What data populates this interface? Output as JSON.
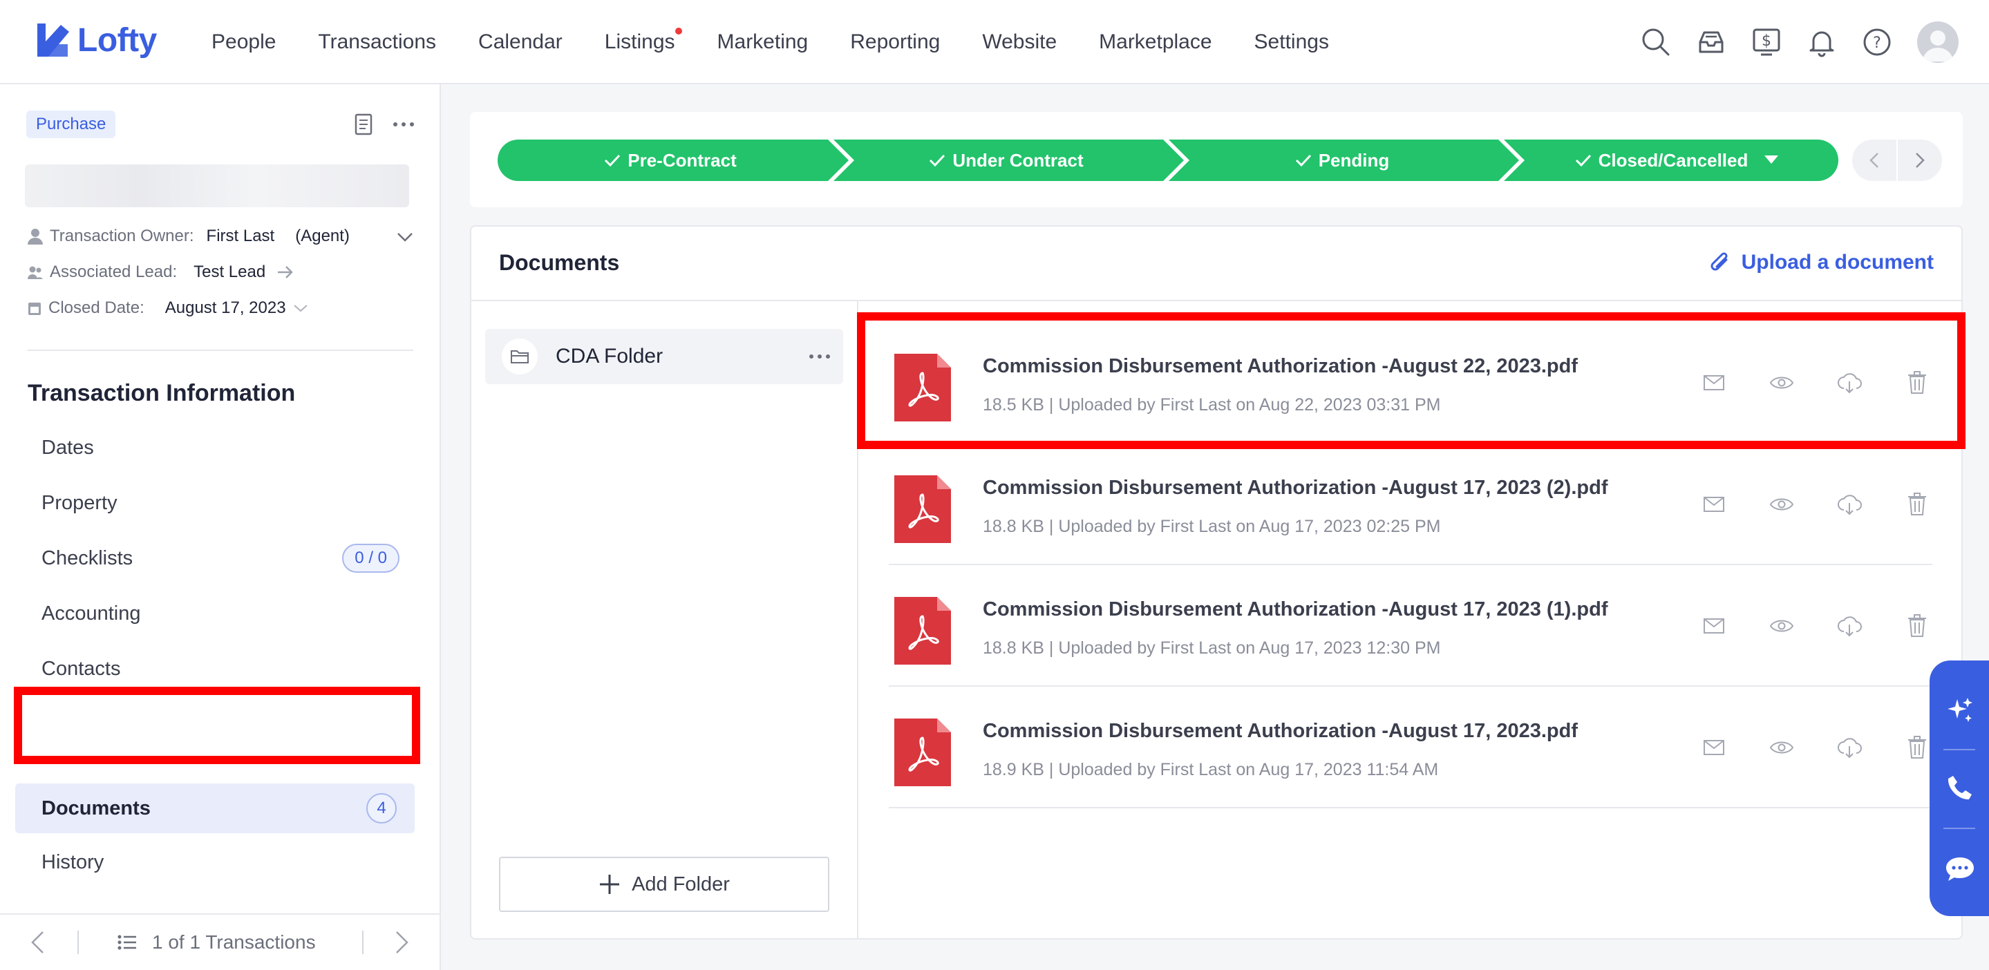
{
  "app": {
    "logo_text": "Lofty",
    "brand_color": "#3a5ee0"
  },
  "nav": {
    "items": [
      "People",
      "Transactions",
      "Calendar",
      "Listings",
      "Marketing",
      "Reporting",
      "Website",
      "Marketplace",
      "Settings"
    ],
    "icons": [
      "search-icon",
      "inbox-icon",
      "dollar-icon",
      "bell-icon",
      "help-icon",
      "avatar"
    ]
  },
  "sidebar": {
    "type_badge": "Purchase",
    "owner_label": "Transaction Owner:",
    "owner_value": "First Last",
    "owner_role": "(Agent)",
    "lead_label": "Associated Lead:",
    "lead_value": "Test Lead",
    "closed_label": "Closed Date:",
    "closed_value": "August 17, 2023",
    "section_title": "Transaction Information",
    "menu": [
      {
        "label": "Dates"
      },
      {
        "label": "Property"
      },
      {
        "label": "Checklists",
        "count": "0 / 0"
      },
      {
        "label": "Accounting"
      },
      {
        "label": "Contacts"
      },
      {
        "label": "Documents",
        "count": "4",
        "active": true
      },
      {
        "label": "History"
      }
    ],
    "footer_text": "1 of 1 Transactions"
  },
  "stages": {
    "items": [
      "Pre-Contract",
      "Under Contract",
      "Pending",
      "Closed/Cancelled"
    ],
    "color": "#22c36b"
  },
  "documents": {
    "title": "Documents",
    "upload_label": "Upload a document",
    "folder_name": "CDA Folder",
    "add_folder_label": "Add Folder",
    "files": [
      {
        "name": "Commission Disbursement Authorization -August 22, 2023.pdf",
        "meta": "18.5 KB | Uploaded by First Last on Aug 22, 2023 03:31 PM"
      },
      {
        "name": "Commission Disbursement Authorization -August 17, 2023 (2).pdf",
        "meta": "18.8 KB | Uploaded by First Last on Aug 17, 2023 02:25 PM"
      },
      {
        "name": "Commission Disbursement Authorization -August 17, 2023 (1).pdf",
        "meta": "18.8 KB | Uploaded by First Last on Aug 17, 2023 12:30 PM"
      },
      {
        "name": "Commission Disbursement Authorization -August 17, 2023.pdf",
        "meta": "18.9 KB | Uploaded by First Last on Aug 17, 2023 11:54 AM"
      }
    ]
  },
  "colors": {
    "highlight": "#ff0000",
    "pdf_red": "#d9363e"
  }
}
